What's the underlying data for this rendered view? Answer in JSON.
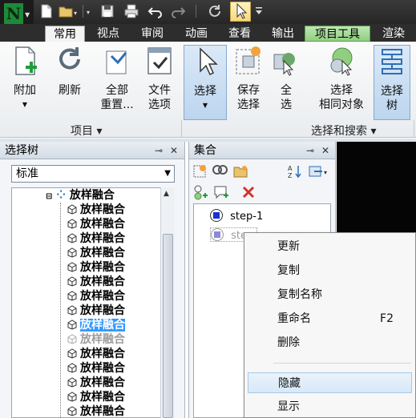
{
  "ribbon_tabs": [
    "常用",
    "视点",
    "审阅",
    "动画",
    "查看",
    "输出",
    "项目工具",
    "渲染"
  ],
  "ribbon_buttons": {
    "append": {
      "label1": "附加"
    },
    "refresh": {
      "label1": "刷新"
    },
    "reset_all": {
      "label1": "全部",
      "label2": "重置..."
    },
    "file_options": {
      "label1": "文件",
      "label2": "选项"
    },
    "select": {
      "label1": "选择"
    },
    "save_selection": {
      "label1": "保存",
      "label2": "选择"
    },
    "select_all": {
      "label1": "全",
      "label2": "选"
    },
    "select_same": {
      "label1": "选择",
      "label2": "相同对象"
    },
    "selection_tree": {
      "label1": "选择",
      "label2": "树"
    }
  },
  "ribbon_groups": {
    "project": "项目 ▾",
    "select_search": "选择和搜索 ▾"
  },
  "selection_tree_panel": {
    "title": "选择树",
    "mode": "标准",
    "root_label": "放样融合",
    "items": [
      "放样融合",
      "放样融合",
      "放样融合",
      "放样融合",
      "放样融合",
      "放样融合",
      "放样融合",
      "放样融合",
      "放样融合",
      "放样融合",
      "放样融合",
      "放样融合",
      "放样融合",
      "放样融合",
      "放样融合"
    ]
  },
  "sets_panel": {
    "title": "集合",
    "sets": [
      "step-1",
      "step"
    ]
  },
  "context_menu": {
    "update": "更新",
    "copy": "复制",
    "copy_name": "复制名称",
    "rename": "重命名",
    "rename_shortcut": "F2",
    "delete": "删除",
    "hide": "隐藏",
    "show": "显示"
  },
  "colors": {
    "accent_selected": "#3399ff",
    "ribbon_context_tab": "#8fcf7f",
    "logo_green": "#1d8a3a"
  }
}
